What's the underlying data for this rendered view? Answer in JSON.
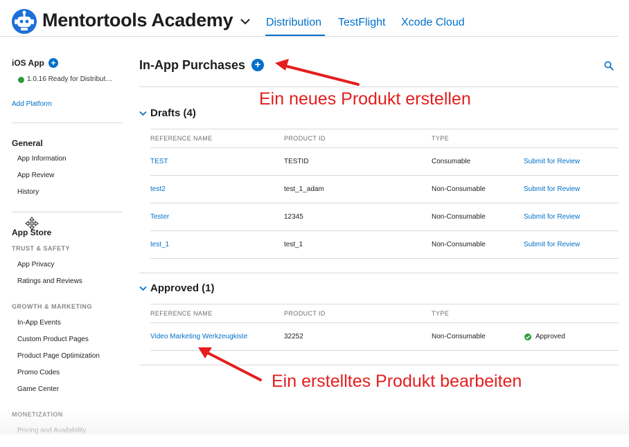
{
  "header": {
    "app_name": "Mentortools Academy",
    "tabs": [
      {
        "label": "Distribution",
        "active": true
      },
      {
        "label": "TestFlight",
        "active": false
      },
      {
        "label": "Xcode Cloud",
        "active": false
      }
    ]
  },
  "sidebar": {
    "platform_title": "iOS App",
    "platform_status": "1.0.16 Ready for Distribut…",
    "add_platform": "Add Platform",
    "general_title": "General",
    "general_items": [
      "App Information",
      "App Review",
      "History"
    ],
    "app_store_title": "App Store",
    "trust_safety_title": "TRUST & SAFETY",
    "trust_safety_items": [
      "App Privacy",
      "Ratings and Reviews"
    ],
    "growth_title": "GROWTH & MARKETING",
    "growth_items": [
      "In-App Events",
      "Custom Product Pages",
      "Product Page Optimization",
      "Promo Codes",
      "Game Center"
    ],
    "monetization_title": "MONETIZATION",
    "monetization_items": [
      "Pricing and Availability"
    ]
  },
  "main": {
    "title": "In-App Purchases",
    "columns": [
      "REFERENCE NAME",
      "PRODUCT ID",
      "TYPE"
    ],
    "drafts": {
      "title": "Drafts (4)",
      "rows": [
        {
          "name": "TEST",
          "product_id": "TESTID",
          "type": "Consumable",
          "action": "Submit for Review"
        },
        {
          "name": "test2",
          "product_id": "test_1_adam",
          "type": "Non-Consumable",
          "action": "Submit for Review"
        },
        {
          "name": "Tester",
          "product_id": "12345",
          "type": "Non-Consumable",
          "action": "Submit for Review"
        },
        {
          "name": "test_1",
          "product_id": "test_1",
          "type": "Non-Consumable",
          "action": "Submit for Review"
        }
      ]
    },
    "approved": {
      "title": "Approved (1)",
      "rows": [
        {
          "name": "Video Marketing Werkzeugkiste",
          "product_id": "32252",
          "type": "Non-Consumable",
          "status": "Approved"
        }
      ]
    }
  },
  "annotations": {
    "create": "Ein neues Produkt erstellen",
    "edit": "Ein erstelltes Produkt bearbeiten"
  },
  "icons": {
    "app_icon": "robot-app-icon",
    "search": "search-icon",
    "add": "plus-circle-icon",
    "status_ok": "green-dot-icon"
  },
  "colors": {
    "accent": "#0070c9",
    "annotation": "#e41e1e",
    "status_ok": "#2a9c3a"
  }
}
